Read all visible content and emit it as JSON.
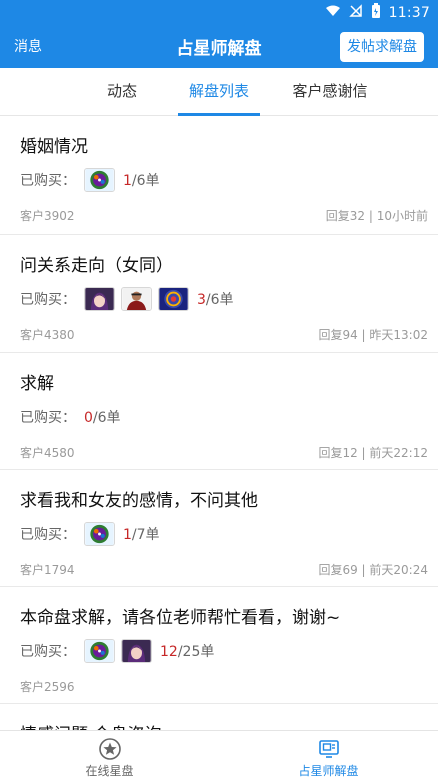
{
  "status_bar": {
    "time": "11:37",
    "icons": [
      "wifi-icon",
      "signal-off-icon",
      "battery-icon"
    ]
  },
  "app_bar": {
    "left": "消息",
    "title": "占星师解盘",
    "action": "发帖求解盘"
  },
  "tabs": [
    {
      "label": "动态",
      "active": false
    },
    {
      "label": "解盘列表",
      "active": true
    },
    {
      "label": "客户感谢信",
      "active": false
    }
  ],
  "posts": [
    {
      "title": "婚姻情况",
      "bought_label": "已购买：",
      "bought_avatars": [
        "chart-wheel-icon"
      ],
      "purchased": "1",
      "purchase_total": "/6单",
      "client": "客户3902",
      "meta_right": "回复32 | 10小时前"
    },
    {
      "title": "问关系走向（女同）",
      "bought_label": "已购买：",
      "bought_avatars": [
        "anime-girl-avatar",
        "man-avatar",
        "mandala-avatar"
      ],
      "purchased": "3",
      "purchase_total": "/6单",
      "client": "客户4380",
      "meta_right": "回复94 | 昨天13:02"
    },
    {
      "title": "求解",
      "bought_label": "已购买：",
      "bought_avatars": [],
      "purchased": "0",
      "purchase_total": "/6单",
      "client": "客户4580",
      "meta_right": "回复12 | 前天22:12"
    },
    {
      "title": "求看我和女友的感情，不问其他",
      "bought_label": "已购买：",
      "bought_avatars": [
        "chart-wheel-icon"
      ],
      "purchased": "1",
      "purchase_total": "/7单",
      "client": "客户1794",
      "meta_right": "回复69 | 前天20:24"
    },
    {
      "title": "本命盘求解，请各位老师帮忙看看，谢谢~",
      "bought_label": "已购买：",
      "bought_avatars": [
        "chart-wheel-icon",
        "anime-girl-avatar"
      ],
      "purchased": "12",
      "purchase_total": "/25单",
      "client": "客户2596",
      "meta_right": ""
    },
    {
      "title": "情感问题 合盘咨询",
      "bought_label": "",
      "bought_avatars": [],
      "purchased": "",
      "purchase_total": "",
      "client": "",
      "meta_right": ""
    }
  ],
  "bottom_nav": [
    {
      "label": "在线星盘",
      "icon": "star-circle-icon",
      "active": false
    },
    {
      "label": "占星师解盘",
      "icon": "chart-reading-icon",
      "active": true
    }
  ],
  "colors": {
    "primary": "#1e88e5",
    "accent_count": "#c62828",
    "muted": "#9a9a9a"
  }
}
